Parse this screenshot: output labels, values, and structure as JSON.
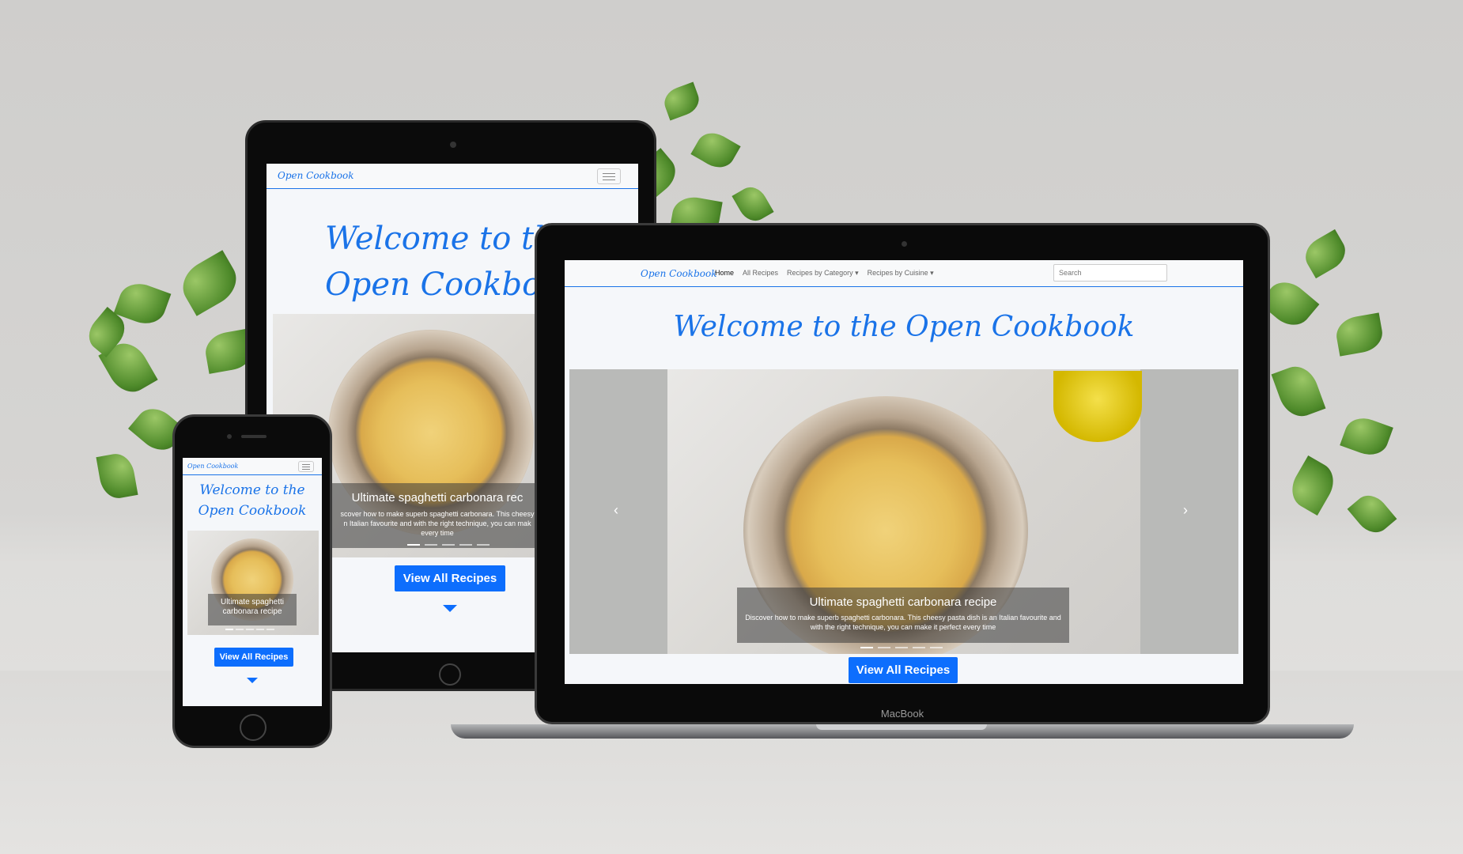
{
  "site": {
    "brand": "Open Cookbook",
    "welcome": "Welcome to the Open Cookbook",
    "welcome_line1": "Welcome to the",
    "welcome_line2": "Open Cookbook",
    "welcome_tablet_line1": "Welcome to th",
    "welcome_tablet_line2": "Open Cookboo",
    "view_all_label": "View All Recipes"
  },
  "nav": {
    "items": [
      {
        "label": "Home",
        "active": true
      },
      {
        "label": "All Recipes"
      },
      {
        "label": "Recipes by Category ▾"
      },
      {
        "label": "Recipes by Cuisine ▾"
      }
    ],
    "search_placeholder": "Search"
  },
  "carousel": {
    "title": "Ultimate spaghetti carbonara recipe",
    "description": "Discover how to make superb spaghetti carbonara. This cheesy pasta dish is an Italian favourite and with the right technique, you can make it perfect every time",
    "tablet_title": "Ultimate spaghetti carbonara rec",
    "tablet_desc_l1": "scover how to make superb spaghetti carbonara. This cheesy",
    "tablet_desc_l2": "n Italian favourite and with the right technique, you can mak",
    "tablet_desc_l3": "every time",
    "phone_title_l1": "Ultimate spaghetti",
    "phone_title_l2": "carbonara recipe",
    "slide_count": 5,
    "active_slide": 1
  },
  "laptop": {
    "label": "MacBook"
  },
  "colors": {
    "accent": "#0d6efd",
    "brand_blue": "#1a73e8"
  },
  "icons": [
    "hamburger-icon",
    "chevron-left-icon",
    "chevron-right-icon",
    "caret-down-icon",
    "camera-icon",
    "home-button-icon"
  ]
}
